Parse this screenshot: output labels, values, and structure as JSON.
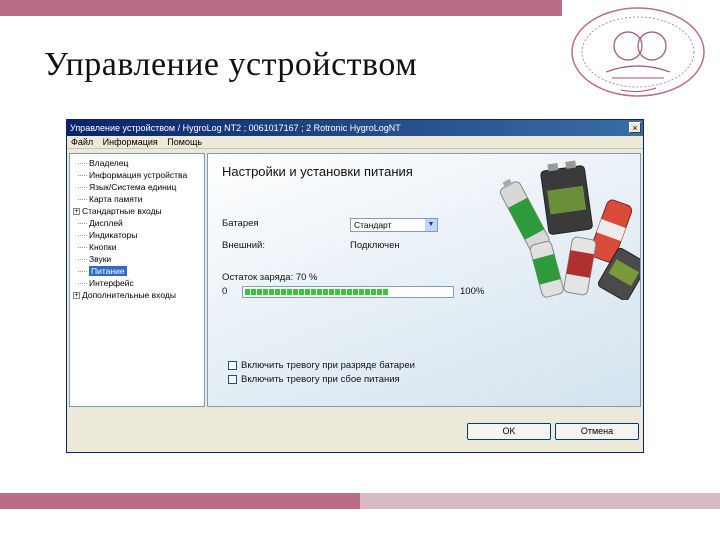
{
  "slide": {
    "title": "Управление устройством"
  },
  "logo": {
    "name": "university-emblem-icon"
  },
  "window": {
    "title": "Управление устройством / HygroLog NT2 ; 0061017167 ; 2 Rotronic HygroLogNT",
    "close_label": "×",
    "menu": [
      "Файл",
      "Информация",
      "Помощь"
    ]
  },
  "tree": {
    "items": [
      {
        "label": "Владелец",
        "expandable": false
      },
      {
        "label": "Информация устройства",
        "expandable": false
      },
      {
        "label": "Язык/Система единиц",
        "expandable": false
      },
      {
        "label": "Карта памяти",
        "expandable": false
      },
      {
        "label": "Стандартные входы",
        "expandable": true
      },
      {
        "label": "Дисплей",
        "expandable": false
      },
      {
        "label": "Индикаторы",
        "expandable": false
      },
      {
        "label": "Кнопки",
        "expandable": false
      },
      {
        "label": "Звуки",
        "expandable": false
      },
      {
        "label": "Питание",
        "expandable": false,
        "selected": true
      },
      {
        "label": "Интерфейс",
        "expandable": false
      },
      {
        "label": "Дополнительные входы",
        "expandable": true
      }
    ]
  },
  "panel": {
    "heading": "Настройки и установки питания",
    "battery_label": "Батарея",
    "battery_value": "Стандарт",
    "external_label": "Внешний:",
    "external_value": "Подключен",
    "charge_label": "Остаток заряда: 70 %",
    "charge_fraction": 0.7,
    "range_min": "0",
    "range_max": "100%",
    "checkbox1_label": "Включить тревогу при разряде батареи",
    "checkbox2_label": "Включить тревогу при сбое питания",
    "checkbox1_checked": false,
    "checkbox2_checked": false
  },
  "buttons": {
    "ok": "OK",
    "cancel": "Отмена"
  },
  "colors": {
    "accent": "#b96e86",
    "accent_light": "#d9b9c3",
    "titlebar": "#0a246a",
    "progress": "#37c837"
  }
}
